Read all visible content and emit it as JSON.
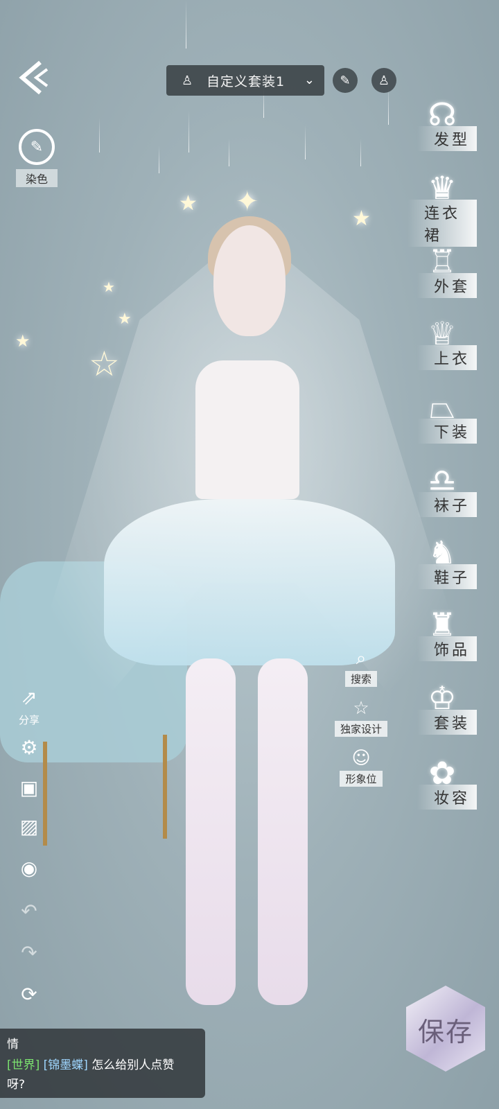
{
  "topbar": {
    "outfit_name": "自定义套装1"
  },
  "left_tools": {
    "dye_label": "染色",
    "share_label": "分享"
  },
  "right_categories": [
    {
      "label": "发型",
      "icon": "hair-icon"
    },
    {
      "label": "连衣裙",
      "icon": "dress-icon"
    },
    {
      "label": "外套",
      "icon": "coat-icon"
    },
    {
      "label": "上衣",
      "icon": "top-icon"
    },
    {
      "label": "下装",
      "icon": "skirt-icon"
    },
    {
      "label": "袜子",
      "icon": "socks-icon"
    },
    {
      "label": "鞋子",
      "icon": "shoes-icon"
    },
    {
      "label": "饰品",
      "icon": "accessory-icon"
    },
    {
      "label": "套装",
      "icon": "suit-icon"
    },
    {
      "label": "妆容",
      "icon": "makeup-icon"
    }
  ],
  "mid_tools": {
    "search_label": "搜索",
    "exclusive_label": "独家设计",
    "image_slot_label": "形象位"
  },
  "save": {
    "label": "保存"
  },
  "chat": {
    "line1": "情",
    "channel": "[世界]",
    "user": "[锦墨蝶]",
    "message": "怎么给别人点赞",
    "message_cont": "呀?"
  }
}
